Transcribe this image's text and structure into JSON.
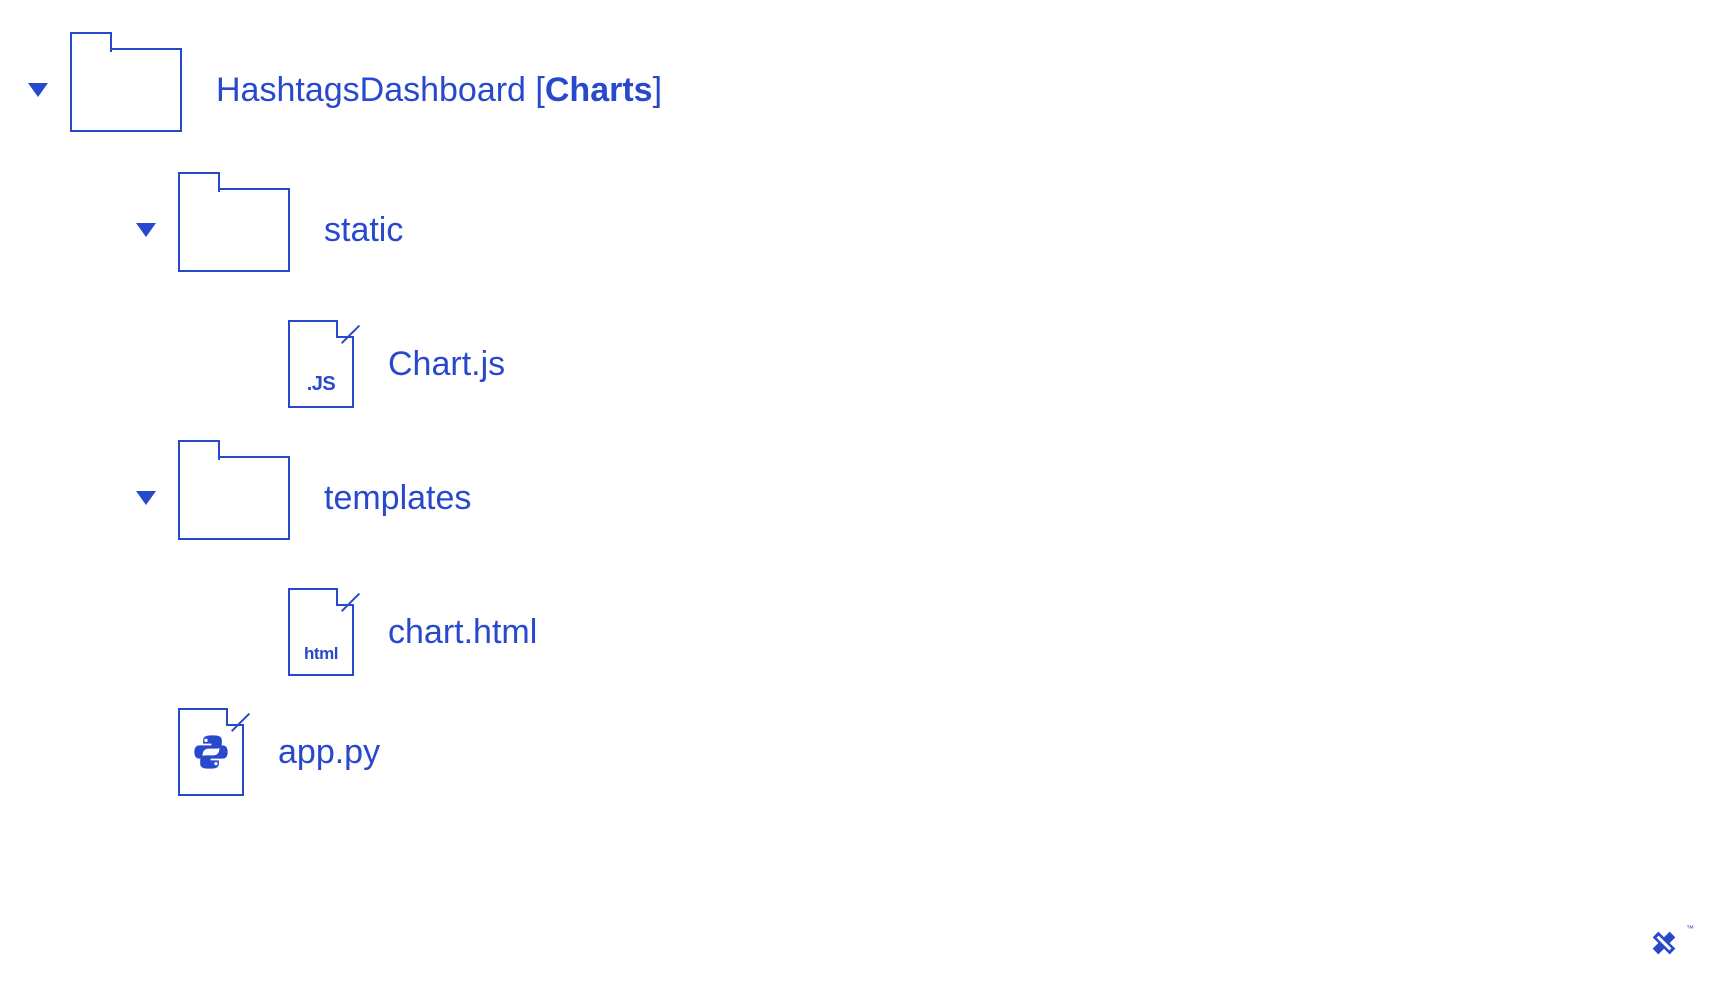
{
  "tree": {
    "root": {
      "name": "HashtagsDashboard",
      "suffix_open": " [",
      "suffix_bold": "Charts",
      "suffix_close": "]"
    },
    "static": {
      "name": "static",
      "children": {
        "chartjs": {
          "name": "Chart.js",
          "badge": ".JS"
        }
      }
    },
    "templates": {
      "name": "templates",
      "children": {
        "charthtml": {
          "name": "chart.html",
          "badge": "html"
        }
      }
    },
    "app": {
      "name": "app.py"
    }
  },
  "logo": {
    "tm": "™"
  }
}
